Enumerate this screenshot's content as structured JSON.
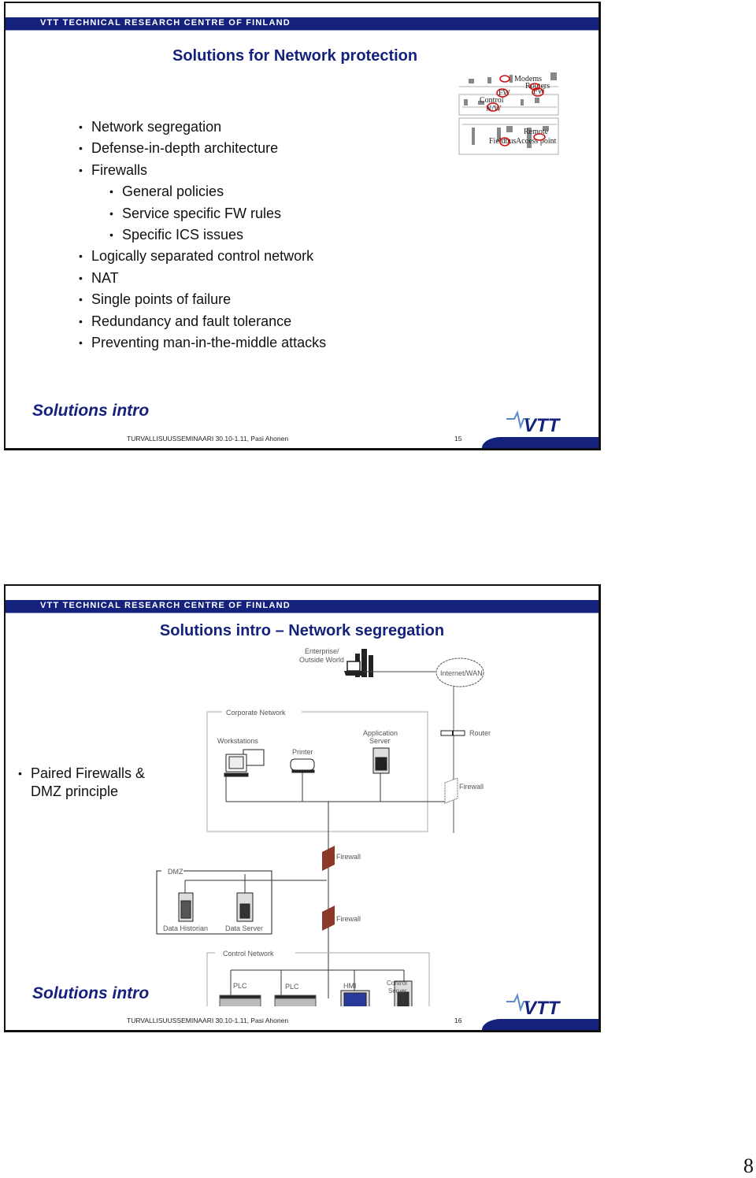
{
  "document": {
    "page_number": "8",
    "org_banner": "VTT TECHNICAL RESEARCH CENTRE OF FINLAND",
    "footer_text": "TURVALLISUUSSEMINAARI 30.10-1.11, Pasi Ahonen",
    "logo_text": "VTT"
  },
  "slides": [
    {
      "number": "15",
      "title": "Solutions for Network protection",
      "section_label": "Solutions intro",
      "bullets": [
        {
          "text": "Network segregation",
          "level": 1
        },
        {
          "text": "Defense-in-depth architecture",
          "level": 1
        },
        {
          "text": "Firewalls",
          "level": 1
        },
        {
          "text": "General policies",
          "level": 2
        },
        {
          "text": "Service specific FW rules",
          "level": 2
        },
        {
          "text": "Specific ICS issues",
          "level": 2
        },
        {
          "text": "Logically separated control network",
          "level": 1
        },
        {
          "text": "NAT",
          "level": 1
        },
        {
          "text": "Single points of failure",
          "level": 1
        },
        {
          "text": "Redundancy and fault tolerance",
          "level": 1
        },
        {
          "text": "Preventing man-in-the-middle attacks",
          "level": 1
        }
      ],
      "diagram_labels": {
        "modems": "Modems",
        "routers": "Routers",
        "fw1": "FW",
        "fw2": "FW",
        "control_nw_1": "Control",
        "control_nw_2": "N/W",
        "remote": "Remote",
        "fieldbus": "Fieldbus",
        "access_point": "Access point"
      }
    },
    {
      "number": "16",
      "title": "Solutions intro – Network segregation",
      "section_label": "Solutions intro",
      "bullets": [
        {
          "text": "Paired Firewalls &",
          "level": 1
        },
        {
          "text": "DMZ principle",
          "level": 0
        }
      ],
      "diagram_labels": {
        "enterprise_1": "Enterprise/",
        "enterprise_2": "Outside World",
        "internet": "Internet/WAN",
        "corporate_network": "Corporate Network",
        "workstations": "Workstations",
        "printer": "Printer",
        "app_server_1": "Application",
        "app_server_2": "Server",
        "router": "Router",
        "firewall_top": "Firewall",
        "firewall_mid": "Firewall",
        "firewall_low": "Firewall",
        "dmz": "DMZ",
        "data_historian": "Data Historian",
        "data_server": "Data Server",
        "control_network": "Control Network",
        "plc1": "PLC",
        "plc2": "PLC",
        "hmi": "HMI",
        "control_server_1": "Control",
        "control_server_2": "Server"
      }
    }
  ],
  "colors": {
    "brand_blue": "#14217d",
    "highlight_red": "#d01010",
    "firewall_brick": "#8b3a2a"
  }
}
